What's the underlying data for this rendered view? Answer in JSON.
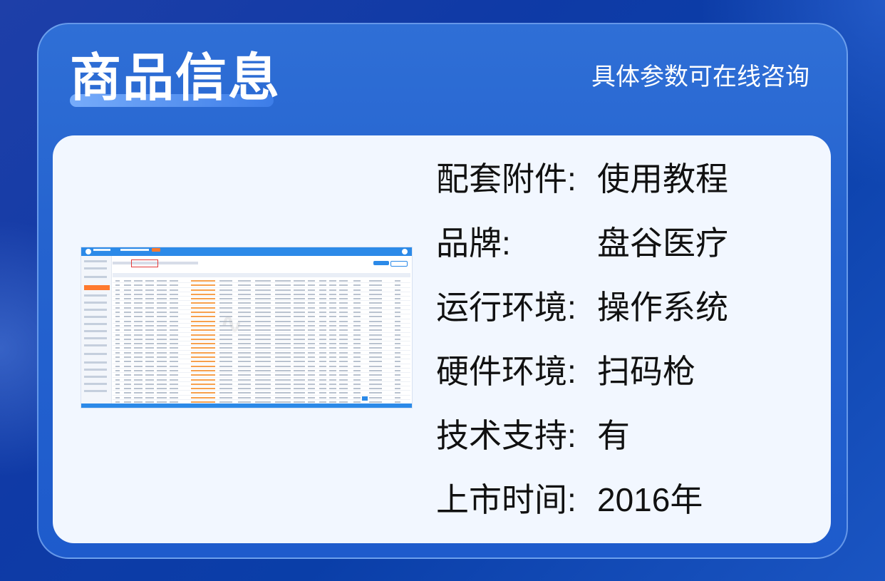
{
  "header": {
    "title": "商品信息",
    "subtitle": "具体参数可在线咨询"
  },
  "specs": [
    {
      "label": "配套附件:",
      "value": "使用教程"
    },
    {
      "label": "品牌:",
      "value": "盘谷医疗"
    },
    {
      "label": "运行环境:",
      "value": "操作系统"
    },
    {
      "label": "硬件环境:",
      "value": "扫码枪"
    },
    {
      "label": "技术支持:",
      "value": "有"
    },
    {
      "label": "上市时间:",
      "value": "2016年"
    }
  ],
  "colors": {
    "background": "#0f3aa6",
    "frame": "#2563cf",
    "card": "#f2f7ff",
    "text": "#111111",
    "accent": "#2c8ae8",
    "highlight": "#ff7a2f"
  }
}
